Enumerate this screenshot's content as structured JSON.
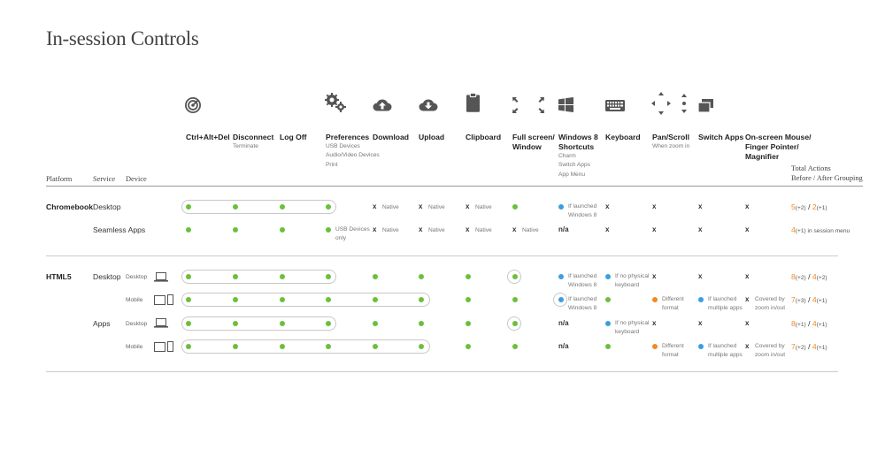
{
  "title": "In-session Controls",
  "columns": [
    {
      "label": "Ctrl+Alt+Del",
      "sub": [],
      "icon": "target-icon"
    },
    {
      "label": "Disconnect",
      "sub": [
        "Terminate"
      ],
      "icon": ""
    },
    {
      "label": "Log Off",
      "sub": [],
      "icon": ""
    },
    {
      "label": "Preferences",
      "sub": [
        "USB Devices",
        "Audio/Video Devices",
        "Print"
      ],
      "icon": "gears-icon"
    },
    {
      "label": "Download",
      "sub": [],
      "icon": "cloud-upload-icon"
    },
    {
      "label": "Upload",
      "sub": [],
      "icon": "cloud-download-icon"
    },
    {
      "label": "Clipboard",
      "sub": [],
      "icon": "clipboard-icon"
    },
    {
      "label": "Full screen/",
      "label2": "Window",
      "sub": [],
      "icon": "fullscreen-icon"
    },
    {
      "label": "Windows 8",
      "label2": "Shortcuts",
      "sub": [
        "Charm",
        "Switch Apps",
        "App Menu"
      ],
      "icon": "windows-icon"
    },
    {
      "label": "Keyboard",
      "sub": [],
      "icon": "keyboard-icon"
    },
    {
      "label": "Pan/Scroll",
      "sub": [
        "When zoom in"
      ],
      "icon": "pan-arrows-icon"
    },
    {
      "label": "Switch Apps",
      "sub": [],
      "icon": "switch-apps-icon"
    },
    {
      "label": "On-screen Mouse/",
      "label2": "Finger Pointer/",
      "label3": "Magnifier",
      "sub": [],
      "icon": ""
    }
  ],
  "headers": {
    "platform": "Platform",
    "service": "Service",
    "device": "Device",
    "total_line1": "Total Actions",
    "total_line2": "Before / After Grouping"
  },
  "rows": {
    "chromebook": {
      "platform": "Chromebook",
      "desktop": {
        "service": "Desktop",
        "x_native": "x",
        "native": "Native",
        "win8_note": [
          "If launched",
          "Windows 8"
        ],
        "x": "x",
        "total": {
          "before": "5",
          "before_delta": "(+2)",
          "sep": " / ",
          "after": "2",
          "after_delta": "(+1)"
        }
      },
      "seamless": {
        "service": "Seamless Apps",
        "pref_note": [
          "USB Devices",
          "only"
        ],
        "x_native": "x",
        "native": "Native",
        "na": "n/a",
        "x": "x",
        "total": {
          "before": "4",
          "before_delta": "(+1)",
          "suffix": " in session menu"
        }
      }
    },
    "html5": {
      "platform": "HTML5",
      "desktop_desktop": {
        "service": "Desktop",
        "device": "Desktop",
        "win8_note": [
          "If launched",
          "Windows 8"
        ],
        "kbd_note": [
          "If no physical",
          "keyboard"
        ],
        "x": "x",
        "total": {
          "before": "8",
          "before_delta": "(+2)",
          "sep": " / ",
          "after": "4",
          "after_delta": "(+2)"
        }
      },
      "desktop_mobile": {
        "device": "Mobile",
        "win8_note": [
          "If launched",
          "Windows 8"
        ],
        "pan_note": [
          "Different",
          "format"
        ],
        "switch_note": [
          "If launched",
          "multiple apps"
        ],
        "mouse_note": [
          "Covered by",
          "zoom in/out"
        ],
        "x": "x",
        "total": {
          "before": "7",
          "before_delta": "(+3)",
          "sep": " / ",
          "after": "4",
          "after_delta": "(+1)"
        }
      },
      "apps_desktop": {
        "service": "Apps",
        "device": "Desktop",
        "na": "n/a",
        "kbd_note": [
          "If no physical",
          "keyboard"
        ],
        "x": "x",
        "total": {
          "before": "8",
          "before_delta": "(+1)",
          "sep": " / ",
          "after": "4",
          "after_delta": "(+1)"
        }
      },
      "apps_mobile": {
        "device": "Mobile",
        "na": "n/a",
        "pan_note": [
          "Different",
          "format"
        ],
        "switch_note": [
          "If launched",
          "multiple apps"
        ],
        "mouse_note": [
          "Covered by",
          "zoom in/out"
        ],
        "x": "x",
        "total": {
          "before": "7",
          "before_delta": "(+2)",
          "sep": " / ",
          "after": "4",
          "after_delta": "(+1)"
        }
      }
    }
  },
  "colors": {
    "green": "#6cbf3c",
    "blue": "#3a9ee4",
    "orange": "#f08a24"
  }
}
